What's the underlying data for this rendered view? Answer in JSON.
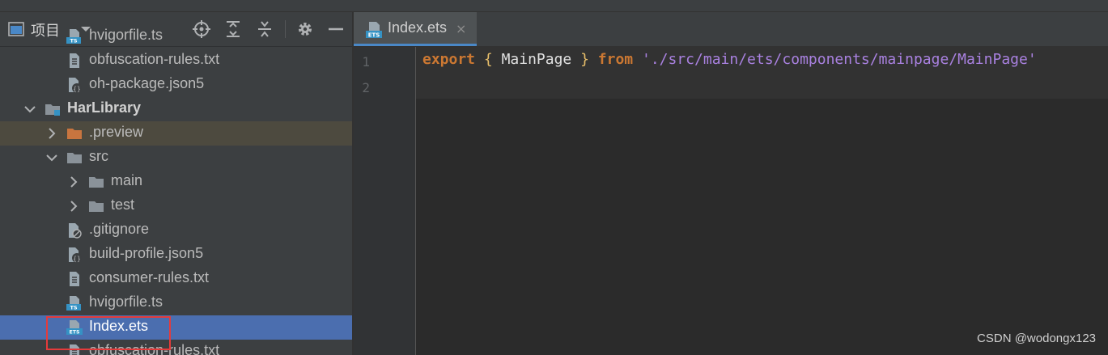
{
  "project_pane": {
    "title": "项目",
    "tree": [
      {
        "label": "hvigorfile.ts",
        "icon": "typescript-file-icon",
        "depth": 2,
        "kind": "file-ts"
      },
      {
        "label": "obfuscation-rules.txt",
        "icon": "text-file-icon",
        "depth": 2,
        "kind": "file-txt"
      },
      {
        "label": "oh-package.json5",
        "icon": "json5-file-icon",
        "depth": 2,
        "kind": "file-json"
      },
      {
        "label": "HarLibrary",
        "icon": "module-folder-icon",
        "depth": 1,
        "kind": "module",
        "expanded": true,
        "bold": true
      },
      {
        "label": ".preview",
        "icon": "orange-folder-icon",
        "depth": 2,
        "kind": "folder-orange",
        "expanded": false,
        "highlighted": true
      },
      {
        "label": "src",
        "icon": "folder-icon",
        "depth": 2,
        "kind": "folder",
        "expanded": true
      },
      {
        "label": "main",
        "icon": "folder-icon",
        "depth": 3,
        "kind": "folder",
        "expanded": false
      },
      {
        "label": "test",
        "icon": "folder-icon",
        "depth": 3,
        "kind": "folder",
        "expanded": false
      },
      {
        "label": ".gitignore",
        "icon": "gitignore-file-icon",
        "depth": 2,
        "kind": "file-git"
      },
      {
        "label": "build-profile.json5",
        "icon": "json5-file-icon",
        "depth": 2,
        "kind": "file-json"
      },
      {
        "label": "consumer-rules.txt",
        "icon": "text-file-icon",
        "depth": 2,
        "kind": "file-txt"
      },
      {
        "label": "hvigorfile.ts",
        "icon": "typescript-file-icon",
        "depth": 2,
        "kind": "file-ts"
      },
      {
        "label": "Index.ets",
        "icon": "ets-file-icon",
        "depth": 2,
        "kind": "file-ets",
        "selected": true
      },
      {
        "label": "obfuscation-rules.txt",
        "icon": "text-file-icon",
        "depth": 2,
        "kind": "file-txt"
      }
    ]
  },
  "editor": {
    "tab": {
      "label": "Index.ets",
      "close": "×",
      "icon": "ets-file-icon"
    },
    "line_numbers": [
      "1",
      "2"
    ],
    "code": {
      "kw_export": "export",
      "brace_open": "{",
      "ident": "MainPage",
      "brace_close": "}",
      "kw_from": "from",
      "path": "'./src/main/ets/components/mainpage/MainPage'"
    }
  },
  "watermark": "CSDN @wodongx123",
  "colors": {
    "panel_bg": "#3c3f41",
    "editor_bg": "#2b2b2b",
    "selection": "#4b6eaf",
    "keyword": "#cc7832",
    "string": "#a981e0",
    "annotation_box": "#e53b3b"
  }
}
